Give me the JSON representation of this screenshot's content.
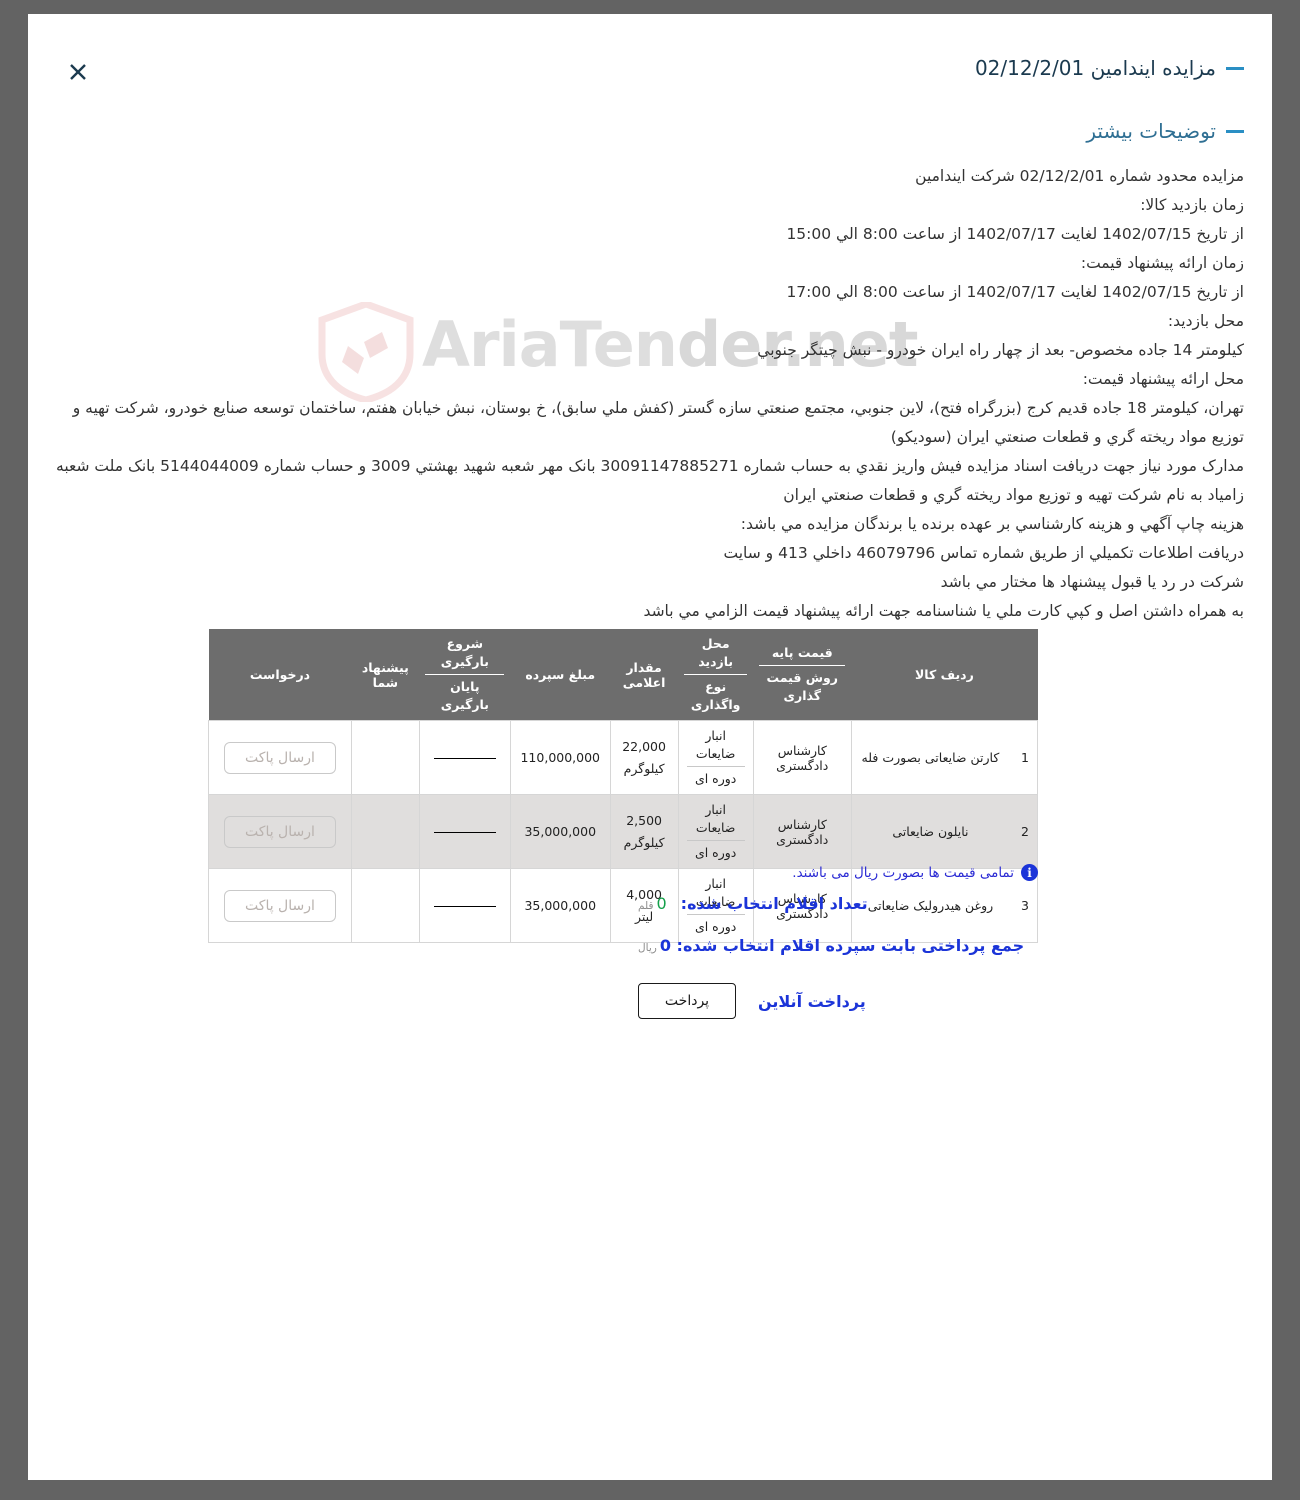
{
  "modal": {
    "close_icon": "close-icon",
    "title": "مزایده ایندامین 02/12/2/01",
    "more_details_title": "توضیحات بیشتر"
  },
  "watermark": {
    "text_main": "AriaTen",
    "text_tail": "der.net"
  },
  "description": {
    "lines": [
      "مزایده محدود شماره 02/12/2/01 شرکت ایندامین",
      "زمان بازدید کالا:",
      "از تاریخ 1402/07/15 لغایت 1402/07/17 از ساعت 8:00 الي 15:00",
      "زمان ارائه پیشنهاد قیمت:",
      "از تاریخ 1402/07/15 لغایت 1402/07/17 از ساعت 8:00 الي 17:00",
      "محل بازدید:",
      "کیلومتر 14 جاده مخصوص- بعد از چهار راه ایران خودرو - نبش چیتگر جنوبي",
      "محل ارائه پیشنهاد قیمت:",
      "تهران، کیلومتر 18 جاده قدیم کرج (بزرگراه فتح)، لاین جنوبي، مجتمع صنعتي سازه گستر (کفش ملي سابق)، خ بوستان، نبش خیابان هفتم، ساختمان توسعه صنایع خودرو، شرکت تهیه و توزیع مواد ریخته گري و قطعات صنعتي ایران (سودیکو)",
      "مدارک مورد نیاز جهت دریافت اسناد مزایده فیش واریز نقدي به حساب شماره 30091147885271 بانک مهر شعبه شهید بهشتي 3009 و حساب شماره 5144044009 بانک ملت شعبه زامیاد به نام شرکت تهیه و توزیع مواد ریخته گري و قطعات صنعتي ایران",
      "هزینه چاپ آگهي و هزینه کارشناسي بر عهده برنده یا برندگان مزایده مي باشد:",
      "دریافت اطلاعات تکمیلي از طریق شماره تماس 46079796 داخلي 413 و سایت",
      "شرکت در رد یا قبول پیشنهاد ها مختار مي باشد",
      "به همراه داشتن اصل و کپي کارت ملي یا شناسنامه جهت ارائه پیشنهاد قیمت الزامي مي باشد"
    ]
  },
  "table": {
    "headers": {
      "row_goods": "ردیف کالا",
      "base_price_top": "قیمت پایه",
      "base_price_bottom": "روش قیمت گذاری",
      "visit_place_top": "محل بازدید",
      "visit_place_bottom": "نوع واگذاری",
      "declared_amount": "مقدار اعلامی",
      "deposit_amount": "مبلغ سپرده",
      "loading_start": "شروع بارگیری",
      "loading_end": "پایان بارگیری",
      "your_offer": "پیشنهاد شما",
      "request": "درخواست"
    },
    "rows": [
      {
        "num": "1",
        "goods": "کارتن ضایعاتی بصورت فله",
        "base_price": "کارشناس دادگستری",
        "visit_place_top": "انبار ضایعات",
        "visit_place_bottom": "دوره ای",
        "amount_value": "22,000",
        "amount_unit": "کیلوگرم",
        "deposit": "110,000,000",
        "loading": "—",
        "your_offer": "",
        "request_label": "ارسال پاکت"
      },
      {
        "num": "2",
        "goods": "نایلون ضایعاتی",
        "base_price": "کارشناس دادگستری",
        "visit_place_top": "انبار ضایعات",
        "visit_place_bottom": "دوره ای",
        "amount_value": "2,500",
        "amount_unit": "کیلوگرم",
        "deposit": "35,000,000",
        "loading": "—",
        "your_offer": "",
        "request_label": "ارسال پاکت"
      },
      {
        "num": "3",
        "goods": "روغن هیدرولیک ضایعاتی",
        "base_price": "کارشناس دادگستری",
        "visit_place_top": "انبار ضایعات",
        "visit_place_bottom": "دوره ای",
        "amount_value": "4,000",
        "amount_unit": "لیتر",
        "deposit": "35,000,000",
        "loading": "—",
        "your_offer": "",
        "request_label": "ارسال پاکت"
      }
    ]
  },
  "note": {
    "icon": "info-icon",
    "text": "تمامی قیمت ها بصورت ریال می باشند."
  },
  "summary": {
    "selected_count_label": "تعداد اقلام انتخاب شده:",
    "selected_count_value": "0",
    "selected_count_unit": "قلم",
    "total_deposit_label": "جمع پرداختی بابت سپرده اقلام انتخاب شده: 0",
    "total_deposit_unit": "ریال",
    "online_payment_label": "پرداخت آنلاین",
    "pay_button_label": "پرداخت"
  },
  "colors": {
    "accent_blue": "#2a8fc4",
    "heading": "#1b3a4f",
    "link_blue": "#1b34d8",
    "green": "#13a04a",
    "table_header_bg": "#6d6d6d",
    "page_bg": "#636363"
  }
}
